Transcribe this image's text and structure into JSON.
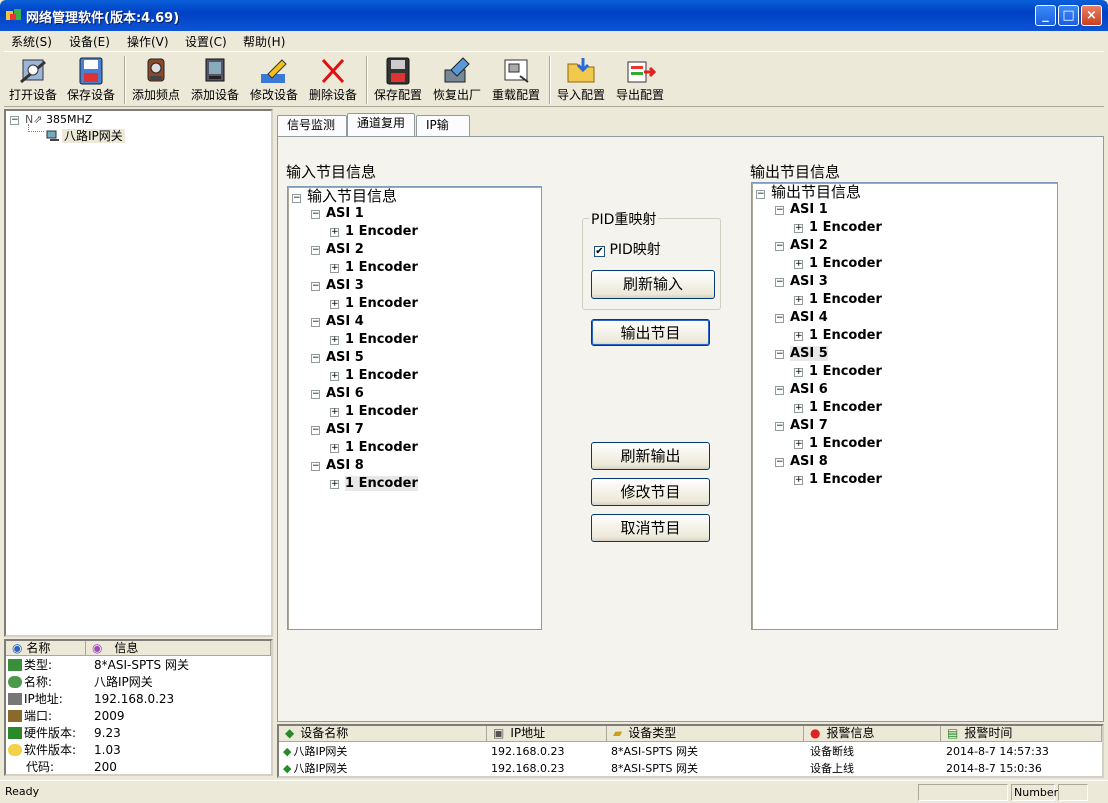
{
  "window": {
    "title": "网络管理软件(版本:4.69)",
    "minimize": "_",
    "maximize": "□",
    "close": "×"
  },
  "menu": [
    "系统(S)",
    "设备(E)",
    "操作(V)",
    "设置(C)",
    "帮助(H)"
  ],
  "toolbar": [
    "打开设备",
    "保存设备",
    "添加频点",
    "添加设备",
    "修改设备",
    "删除设备",
    "保存配置",
    "恢复出厂",
    "重载配置",
    "导入配置",
    "导出配置"
  ],
  "left_tree": {
    "root": "385MHZ",
    "child": "八路IP网关"
  },
  "info_panel": {
    "col_name": "名称",
    "col_info": "信息",
    "rows": [
      {
        "label": "类型:",
        "value": "8*ASI-SPTS 网关"
      },
      {
        "label": "名称:",
        "value": "八路IP网关"
      },
      {
        "label": "IP地址:",
        "value": "192.168.0.23"
      },
      {
        "label": "端口:",
        "value": "2009"
      },
      {
        "label": "硬件版本:",
        "value": "9.23"
      },
      {
        "label": "软件版本:",
        "value": "1.03"
      },
      {
        "label": "代码:",
        "value": "200"
      }
    ]
  },
  "tabs": [
    "信号监测",
    "通道复用",
    "IP输出"
  ],
  "active_tab": 1,
  "input_panel": {
    "heading": "输入节目信息",
    "root": "输入节目信息",
    "groups": [
      "ASI 1",
      "ASI 2",
      "ASI 3",
      "ASI 4",
      "ASI 5",
      "ASI 6",
      "ASI 7",
      "ASI 8"
    ],
    "child": "1 Encoder"
  },
  "output_panel": {
    "heading": "输出节目信息",
    "root": "输出节目信息",
    "groups": [
      "ASI 1",
      "ASI 2",
      "ASI 3",
      "ASI 4",
      "ASI 5",
      "ASI 6",
      "ASI 7",
      "ASI 8"
    ],
    "child": "1 Encoder"
  },
  "pid_group": {
    "legend": "PID重映射",
    "checkbox_label": "PID映射",
    "checked": true,
    "refresh_input": "刷新输入"
  },
  "buttons": {
    "output_program": "输出节目",
    "refresh_output": "刷新输出",
    "modify_program": "修改节目",
    "cancel_program": "取消节目"
  },
  "device_list": {
    "columns": [
      "设备名称",
      "IP地址",
      "设备类型",
      "报警信息",
      "报警时间"
    ],
    "rows": [
      [
        "八路IP网关",
        "192.168.0.23",
        "8*ASI-SPTS 网关",
        "设备断线",
        "2014-8-7 14:57:33"
      ],
      [
        "八路IP网关",
        "192.168.0.23",
        "8*ASI-SPTS 网关",
        "设备上线",
        "2014-8-7 15:0:36"
      ]
    ]
  },
  "status": {
    "left": "Ready",
    "number": "Number"
  }
}
